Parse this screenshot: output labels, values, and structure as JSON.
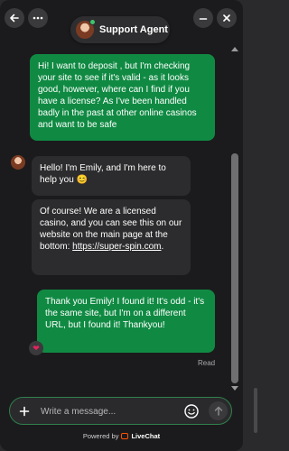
{
  "header": {
    "agent_name": "Support Agent"
  },
  "messages": [
    {
      "sender": "user",
      "text": "Hi! I want to deposit , but I'm checking your site to see if it's valid - as it looks good, however, where can I find if you have a license? As I've been handled badly in the past at other online casinos and want to be safe"
    },
    {
      "sender": "agent",
      "text": "Hello! I'm Emily, and I'm here to help you 😊"
    },
    {
      "sender": "agent",
      "text_before": "Of course! We are a licensed casino, and you can see this on our website on the main page at the bottom: ",
      "link": "https://super-spin.com",
      "text_after": "."
    },
    {
      "sender": "user",
      "text": "Thank you Emily! I found it! It's odd - it's the same site, but I'm on a different URL, but I found it! Thankyou!"
    }
  ],
  "reaction": "❤",
  "read_label": "Read",
  "composer": {
    "placeholder": "Write a message..."
  },
  "footer": {
    "powered_by": "Powered by",
    "brand": "LiveChat"
  },
  "colors": {
    "user_bubble": "#108a43",
    "agent_bubble": "#2c2c2e",
    "background": "#1b1b1d",
    "brand_orange": "#ff5100"
  }
}
